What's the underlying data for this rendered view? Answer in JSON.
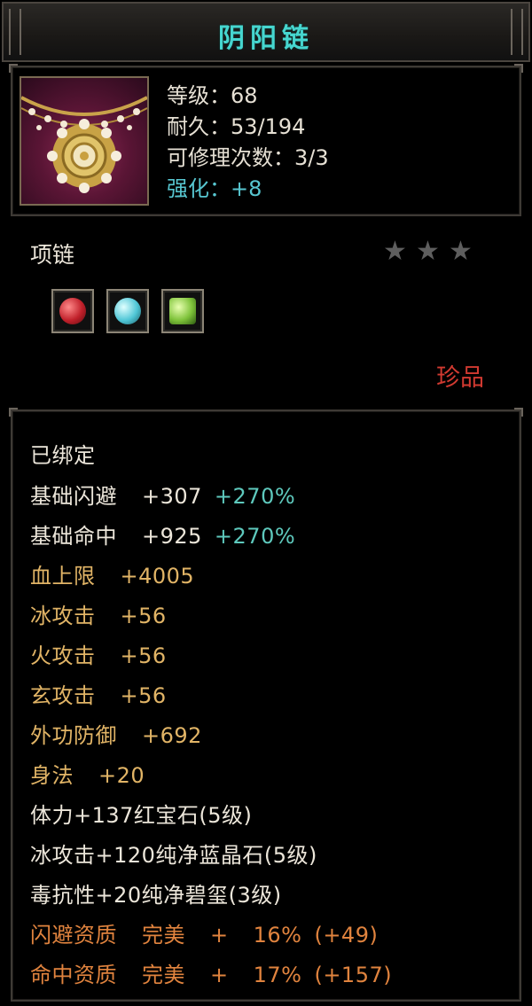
{
  "title": "阴阳链",
  "info": {
    "level": "等级：68",
    "durability": "耐久：53/194",
    "repair_count": "可修理次数：3/3",
    "enhance": "强化：+8"
  },
  "item_type": "项链",
  "stars": {
    "count": 3,
    "color": "#5e5e5e"
  },
  "gems": [
    {
      "icon": "red-gem-icon",
      "color": "#c0202a"
    },
    {
      "icon": "blue-gem-icon",
      "color": "#4fc6d6"
    },
    {
      "icon": "green-gem-icon",
      "color": "#7ec23a"
    }
  ],
  "rarity": "珍品",
  "stats": {
    "bound": "已绑定",
    "base_dodge": {
      "label": "基础闪避",
      "value": "+307",
      "bonus": "+270%"
    },
    "base_hit": {
      "label": "基础命中",
      "value": "+925",
      "bonus": "+270%"
    },
    "hp_max": {
      "label": "血上限",
      "value": "+4005"
    },
    "ice_attack": {
      "label": "冰攻击",
      "value": "+56"
    },
    "fire_attack": {
      "label": "火攻击",
      "value": "+56"
    },
    "mystic_attack": {
      "label": "玄攻击",
      "value": "+56"
    },
    "outer_defense": {
      "label": "外功防御",
      "value": "+692"
    },
    "agility": {
      "label": "身法",
      "value": "+20"
    },
    "gem_line_1": "体力+137红宝石(5级)",
    "gem_line_2": "冰攻击+120纯净蓝晶石(5级)",
    "gem_line_3": "毒抗性+20纯净碧玺(3级)",
    "dodge_quality": {
      "label": "闪避资质",
      "grade": "完美",
      "plus": "+",
      "pct": "16%",
      "extra": "(+49)"
    },
    "hit_quality": {
      "label": "命中资质",
      "grade": "完美",
      "plus": "+",
      "pct": "17%",
      "extra": "(+157)"
    }
  }
}
